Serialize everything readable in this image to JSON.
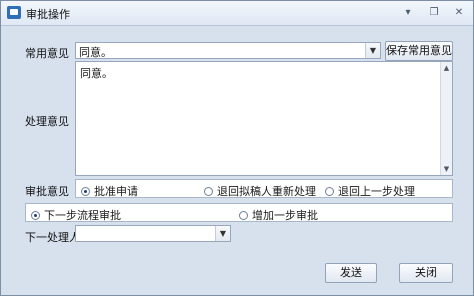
{
  "window": {
    "title": "审批操作",
    "icon": "app-icon"
  },
  "titlebar": {
    "buttons": [
      "pin-icon",
      "restore-icon",
      "close-icon"
    ]
  },
  "common_opinion": {
    "label": "常用意见",
    "value": "同意。",
    "save_button": "保存常用意见"
  },
  "handling_opinion": {
    "label": "处理意见",
    "value": "同意。"
  },
  "approval_opinion": {
    "label": "审批意见",
    "options": [
      {
        "label": "批准申请",
        "selected": true
      },
      {
        "label": "退回拟稿人重新处理",
        "selected": false
      },
      {
        "label": "退回上一步处理",
        "selected": false
      }
    ]
  },
  "next_step": {
    "options": [
      {
        "label": "下一步流程审批",
        "selected": true
      },
      {
        "label": "增加一步审批",
        "selected": false
      }
    ]
  },
  "next_handler": {
    "label": "下一处理人",
    "value": ""
  },
  "footer": {
    "send_button": "发送",
    "close_button": "关闭"
  }
}
